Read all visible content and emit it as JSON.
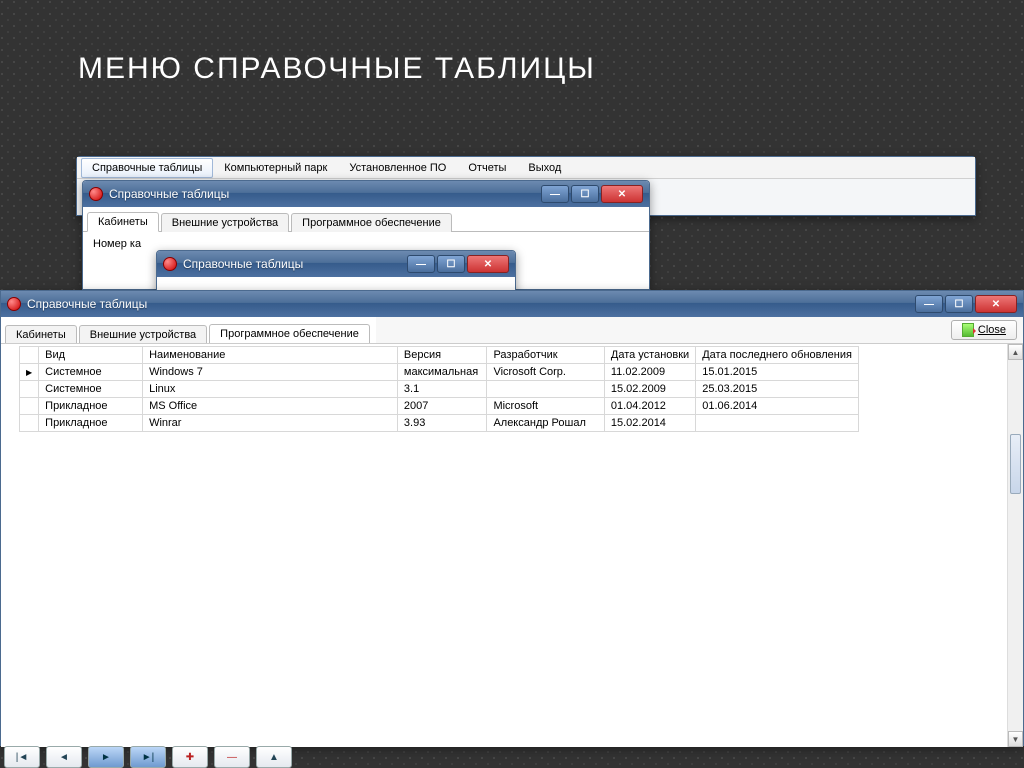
{
  "slide_title": "МЕНЮ СПРАВОЧНЫЕ ТАБЛИЦЫ",
  "main_window": {
    "menubar": [
      "Справочные таблицы",
      "Компьютерный парк",
      "Установленное ПО",
      "Отчеты",
      "Выход"
    ]
  },
  "win_a": {
    "title": "Справочные таблицы",
    "tabs": [
      "Кабинеты",
      "Внешние устройства",
      "Программное обеспечение"
    ],
    "field_label": "Номер ка"
  },
  "win_b": {
    "title": "Справочные таблицы"
  },
  "front": {
    "title": "Справочные таблицы",
    "tabs": [
      "Кабинеты",
      "Внешние устройства",
      "Программное обеспечение"
    ],
    "close_label": "Close",
    "columns": [
      "Вид",
      "Наименование",
      "Версия",
      "Разработчик",
      "Дата установки",
      "Дата последнего обновления"
    ],
    "rows": [
      {
        "vid": "Системное",
        "name": "Windows 7",
        "ver": "максимальная",
        "dev": "Vicrosoft Corp.",
        "inst": "11.02.2009",
        "upd": "15.01.2015"
      },
      {
        "vid": "Системное",
        "name": "Linux",
        "ver": "3.1",
        "dev": "",
        "inst": "15.02.2009",
        "upd": "25.03.2015"
      },
      {
        "vid": "Прикладное",
        "name": "MS Office",
        "ver": "2007",
        "dev": "Microsoft",
        "inst": "01.04.2012",
        "upd": "01.06.2014"
      },
      {
        "vid": "Прикладное",
        "name": "Winrar",
        "ver": "3.93",
        "dev": "Александр Рошал",
        "inst": "15.02.2014",
        "upd": ""
      }
    ]
  }
}
